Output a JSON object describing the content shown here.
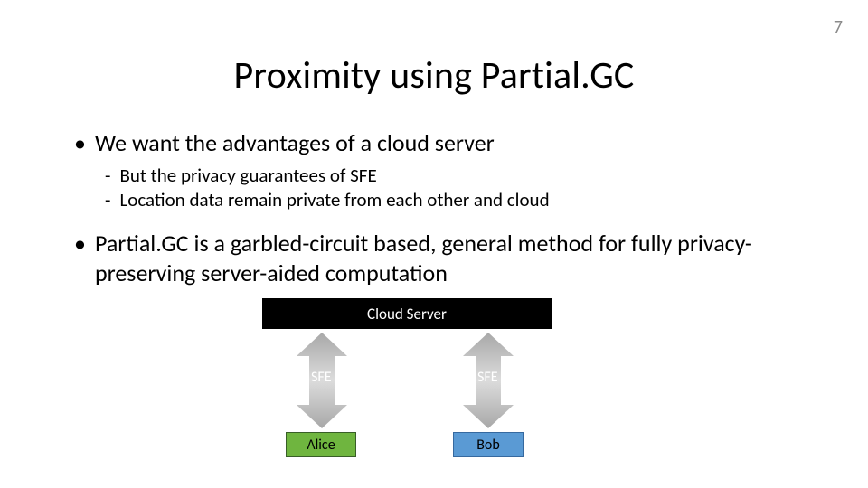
{
  "page_number": "7",
  "title": "Proximity using Partial.GC",
  "bullets": {
    "b1": "We want the advantages of a cloud server",
    "b1_sub": {
      "s1": "But the privacy guarantees of SFE",
      "s2": "Location data remain private from each other and cloud"
    },
    "b2": "Partial.GC is a garbled-circuit based, general method for fully privacy-preserving server-aided computation"
  },
  "diagram": {
    "cloud": "Cloud Server",
    "sfe": "SFE",
    "alice": "Alice",
    "bob": "Bob"
  },
  "colors": {
    "alice_fill": "#6fb53f",
    "bob_fill": "#5a9ad4",
    "cloud_fill": "#000000"
  }
}
